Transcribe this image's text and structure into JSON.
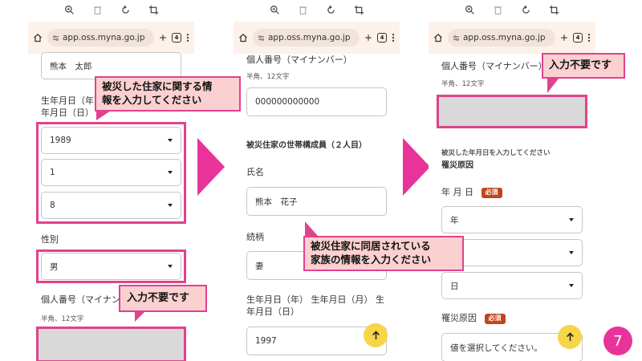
{
  "browser": {
    "url": "app.oss.myna.go.jp",
    "tab_count": "4"
  },
  "screen1": {
    "name_value": "熊本　太郎",
    "birth_label_line1": "生年月日（年）",
    "birth_label_line2": "年月日（日）",
    "year_value": "1989",
    "month_value": "1",
    "day_value": "8",
    "gender_label": "性別",
    "gender_value": "男",
    "mynumber_label": "個人番号（マイナン",
    "mynumber_hint": "半角、12文字",
    "callout_info_line1": "被災した住家に関する情",
    "callout_info_line2": "報を入力してください",
    "callout_not_required": "入力不要です"
  },
  "screen2": {
    "mynumber_label": "個人番号（マイナンバー）",
    "mynumber_hint": "半角、12文字",
    "mynumber_value": "000000000000",
    "section_title": "被災住家の世帯構成員（２人目）",
    "name_label": "氏名",
    "name_value": "熊本　花子",
    "relation_label": "続柄",
    "relation_value": "妻",
    "birth_label_line1": "生年月日（年） 生年月日（月） 生",
    "birth_label_line2": "年月日（日）",
    "birth_year_value": "1997",
    "callout_line1": "被災住家に同居されている",
    "callout_line2": "家族の情報を入力ください"
  },
  "screen3": {
    "mynumber_label": "個人番号（マイナンバー）",
    "mynumber_hint": "半角、12文字",
    "callout_not_required": "入力不要です",
    "date_prompt": "被災した年月日を入力してください",
    "cause_heading": "罹災原因",
    "date_label": "年 月 日",
    "required_badge": "必須",
    "year_placeholder": "年",
    "day_placeholder": "日",
    "cause_label": "罹災原因",
    "cause_placeholder": "値を選択してください。"
  },
  "page_number": "7"
}
